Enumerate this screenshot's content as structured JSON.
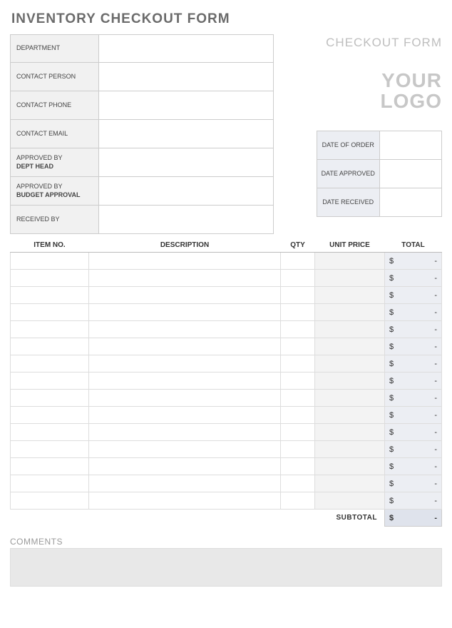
{
  "title": "INVENTORY CHECKOUT FORM",
  "subtitle": "CHECKOUT FORM",
  "logo_text": "YOUR LOGO",
  "left_fields": [
    {
      "label": "DEPARTMENT",
      "bold": "",
      "value": ""
    },
    {
      "label": "CONTACT PERSON",
      "bold": "",
      "value": ""
    },
    {
      "label": "CONTACT PHONE",
      "bold": "",
      "value": ""
    },
    {
      "label": "CONTACT EMAIL",
      "bold": "",
      "value": ""
    },
    {
      "label": "APPROVED BY",
      "bold": "DEPT HEAD",
      "value": ""
    },
    {
      "label": "APPROVED BY",
      "bold": "BUDGET APPROVAL",
      "value": ""
    },
    {
      "label": "RECEIVED BY",
      "bold": "",
      "value": ""
    }
  ],
  "date_fields": [
    {
      "label": "DATE OF ORDER",
      "value": ""
    },
    {
      "label": "DATE APPROVED",
      "value": ""
    },
    {
      "label": "DATE RECEIVED",
      "value": ""
    }
  ],
  "items_header": {
    "item_no": "ITEM NO.",
    "description": "DESCRIPTION",
    "qty": "QTY",
    "unit_price": "UNIT PRICE",
    "total": "TOTAL"
  },
  "line_items": [
    {
      "item_no": "",
      "description": "",
      "qty": "",
      "unit_price": "",
      "total_currency": "$",
      "total_value": "-"
    },
    {
      "item_no": "",
      "description": "",
      "qty": "",
      "unit_price": "",
      "total_currency": "$",
      "total_value": "-"
    },
    {
      "item_no": "",
      "description": "",
      "qty": "",
      "unit_price": "",
      "total_currency": "$",
      "total_value": "-"
    },
    {
      "item_no": "",
      "description": "",
      "qty": "",
      "unit_price": "",
      "total_currency": "$",
      "total_value": "-"
    },
    {
      "item_no": "",
      "description": "",
      "qty": "",
      "unit_price": "",
      "total_currency": "$",
      "total_value": "-"
    },
    {
      "item_no": "",
      "description": "",
      "qty": "",
      "unit_price": "",
      "total_currency": "$",
      "total_value": "-"
    },
    {
      "item_no": "",
      "description": "",
      "qty": "",
      "unit_price": "",
      "total_currency": "$",
      "total_value": "-"
    },
    {
      "item_no": "",
      "description": "",
      "qty": "",
      "unit_price": "",
      "total_currency": "$",
      "total_value": "-"
    },
    {
      "item_no": "",
      "description": "",
      "qty": "",
      "unit_price": "",
      "total_currency": "$",
      "total_value": "-"
    },
    {
      "item_no": "",
      "description": "",
      "qty": "",
      "unit_price": "",
      "total_currency": "$",
      "total_value": "-"
    },
    {
      "item_no": "",
      "description": "",
      "qty": "",
      "unit_price": "",
      "total_currency": "$",
      "total_value": "-"
    },
    {
      "item_no": "",
      "description": "",
      "qty": "",
      "unit_price": "",
      "total_currency": "$",
      "total_value": "-"
    },
    {
      "item_no": "",
      "description": "",
      "qty": "",
      "unit_price": "",
      "total_currency": "$",
      "total_value": "-"
    },
    {
      "item_no": "",
      "description": "",
      "qty": "",
      "unit_price": "",
      "total_currency": "$",
      "total_value": "-"
    },
    {
      "item_no": "",
      "description": "",
      "qty": "",
      "unit_price": "",
      "total_currency": "$",
      "total_value": "-"
    }
  ],
  "subtotal": {
    "label": "SUBTOTAL",
    "currency": "$",
    "value": "-"
  },
  "comments": {
    "label": "COMMENTS",
    "value": ""
  }
}
